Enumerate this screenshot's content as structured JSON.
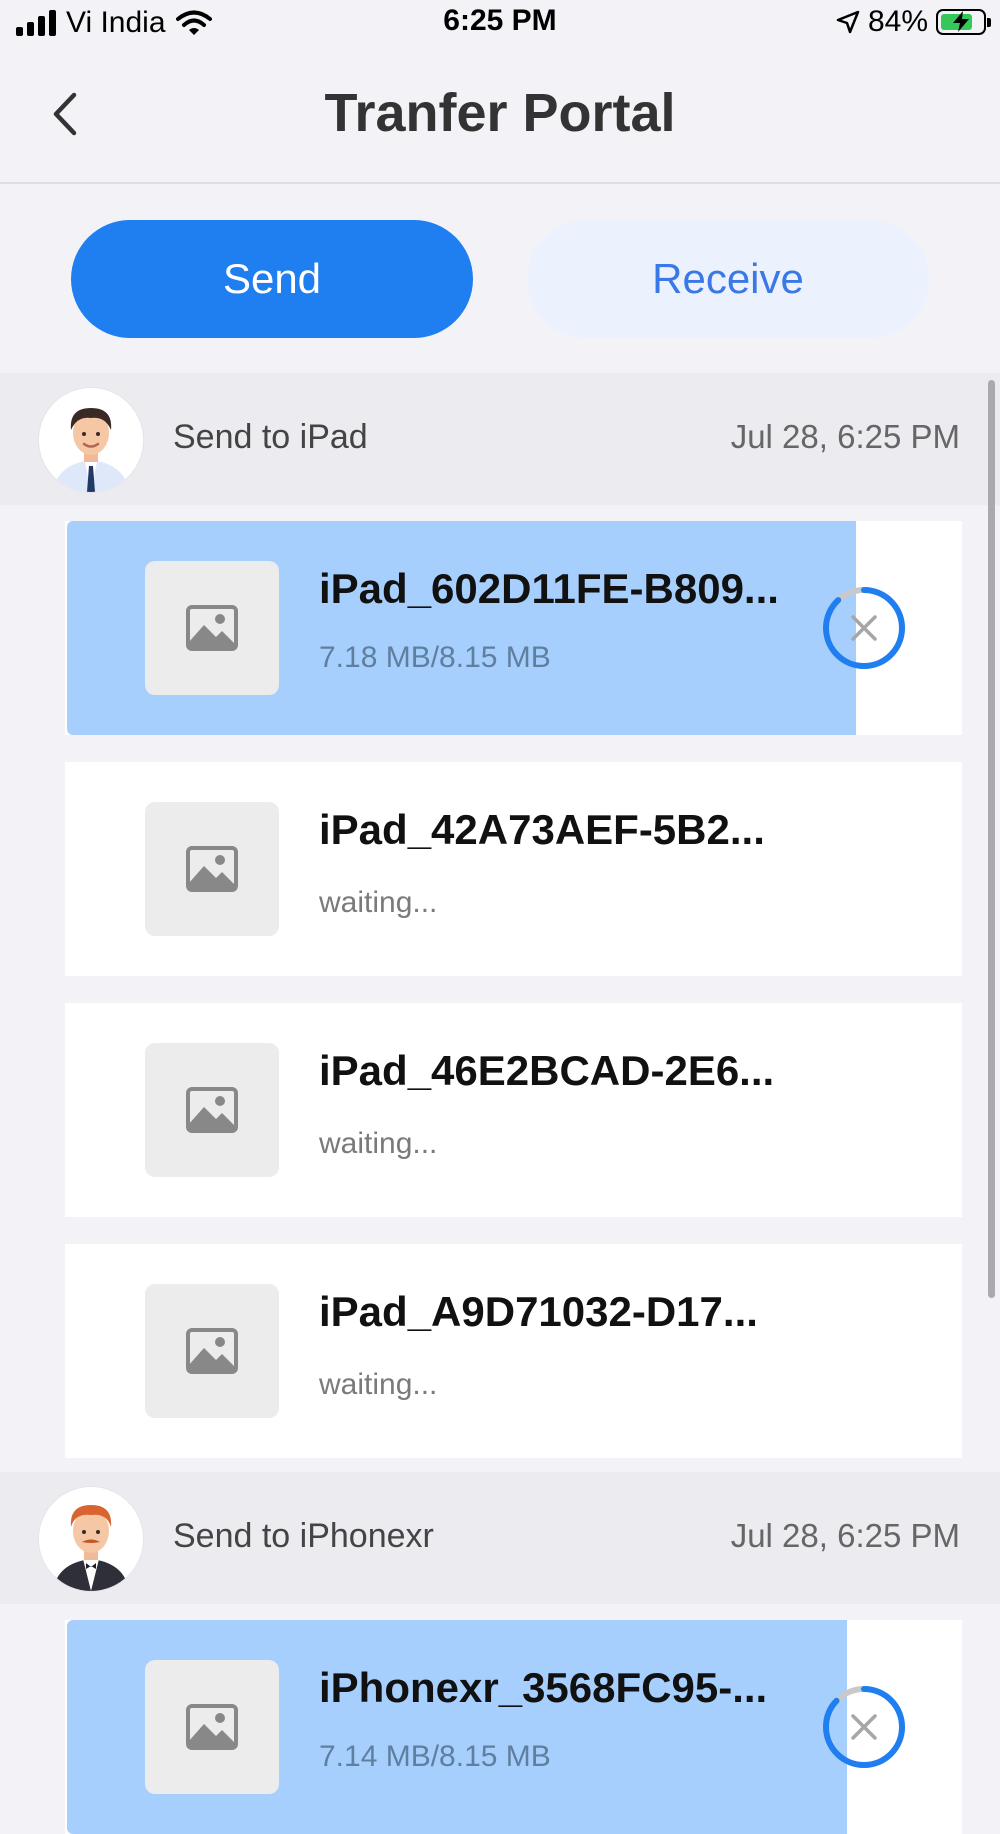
{
  "status_bar": {
    "carrier": "Vi India",
    "time": "6:25 PM",
    "battery": "84%",
    "battery_level": 0.84
  },
  "header": {
    "title": "Tranfer Portal",
    "back_icon": "chevron-left-icon"
  },
  "segments": {
    "send_label": "Send",
    "receive_label": "Receive",
    "selected": "send"
  },
  "groups": [
    {
      "title": "Send to iPad",
      "time": "Jul 28, 6:25 PM",
      "files": [
        {
          "name": "iPad_602D11FE-B809...",
          "status": "7.18 MB/8.15 MB",
          "progress": 0.88
        },
        {
          "name": "iPad_42A73AEF-5B2...",
          "status": "waiting..."
        },
        {
          "name": "iPad_46E2BCAD-2E6...",
          "status": "waiting..."
        },
        {
          "name": "iPad_A9D71032-D17...",
          "status": "waiting..."
        }
      ]
    },
    {
      "title": "Send to iPhonexr",
      "time": "Jul 28, 6:25 PM",
      "files": [
        {
          "name": "iPhonexr_3568FC95-...",
          "status": "7.14 MB/8.15 MB",
          "progress": 0.87
        }
      ]
    }
  ],
  "colors": {
    "accent": "#1f7ff0",
    "progress_fill": "#a7cffd",
    "receive_bg": "#ebf2fd"
  }
}
